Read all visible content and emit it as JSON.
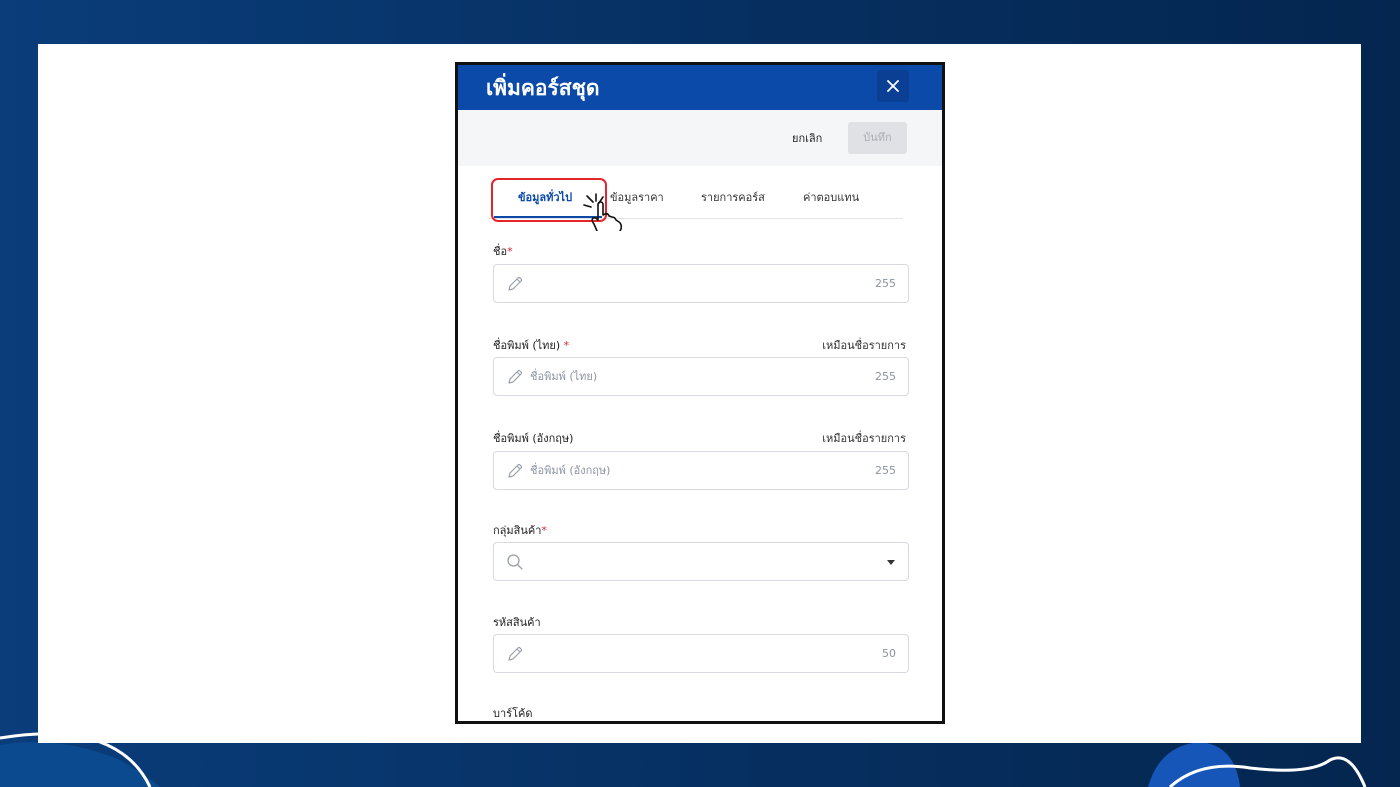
{
  "dialog": {
    "title": "เพิ่มคอร์สชุด",
    "cancel_label": "ยกเลิก",
    "save_label": "บันทึก"
  },
  "tabs": [
    {
      "label": "ข้อมูลทั่วไป",
      "active": true
    },
    {
      "label": "ข้อมูลราคา",
      "active": false
    },
    {
      "label": "รายการคอร์ส",
      "active": false
    },
    {
      "label": "ค่าตอบแทน",
      "active": false
    }
  ],
  "fields": {
    "name": {
      "label": "ชื่อ",
      "required": "*",
      "value": "",
      "placeholder": "",
      "counter": "255"
    },
    "print_name_th": {
      "label": "ชื่อพิมพ์ (ไทย) ",
      "required": "*",
      "value": "",
      "placeholder": "ชื่อพิมพ์ (ไทย)",
      "counter": "255",
      "side_link": "เหมือนชื่อรายการ"
    },
    "print_name_en": {
      "label": "ชื่อพิมพ์ (อังกฤษ)",
      "value": "",
      "placeholder": "ชื่อพิมพ์ (อังกฤษ)",
      "counter": "255",
      "side_link": "เหมือนชื่อรายการ"
    },
    "product_group": {
      "label": "กลุ่มสินค้า",
      "required": "*",
      "value": "",
      "placeholder": ""
    },
    "product_code": {
      "label": "รหัสสินค้า",
      "value": "",
      "placeholder": "",
      "counter": "50"
    },
    "barcode": {
      "label": "บาร์โค้ด"
    }
  },
  "colors": {
    "header": "#0b4aa8",
    "accent": "#0b4aa8",
    "required": "#e2262b",
    "highlight": "#e2262b",
    "background": "#062f60"
  }
}
